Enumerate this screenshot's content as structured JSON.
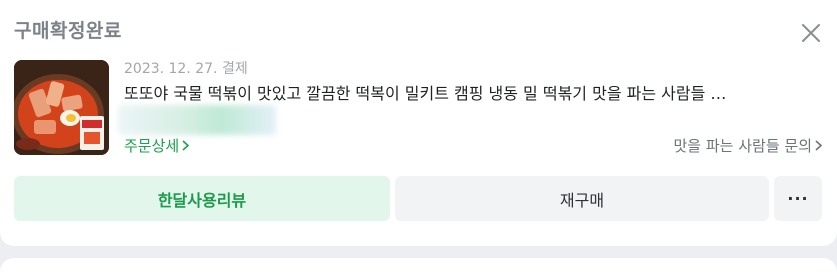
{
  "order": {
    "status": "구매확정완료",
    "date": "2023. 12. 27. 결제",
    "product_title": "또또야 국물 떡볶이 맛있고 깔끔한 떡복이 밀키트 캠핑 냉동 밀 떡볶기 맛을 파는 사람들 …",
    "order_detail_label": "주문상세",
    "seller_inquiry_label": "맛을 파는 사람들 문의"
  },
  "actions": {
    "review_label": "한달사용리뷰",
    "rebuy_label": "재구매",
    "more_label": "···"
  },
  "icons": {
    "close": "close-icon",
    "chevron": "chevron-right-icon"
  },
  "colors": {
    "green": "#1a9b4b",
    "review_bg": "#e3f6ec",
    "status_gray": "#7d8288"
  }
}
